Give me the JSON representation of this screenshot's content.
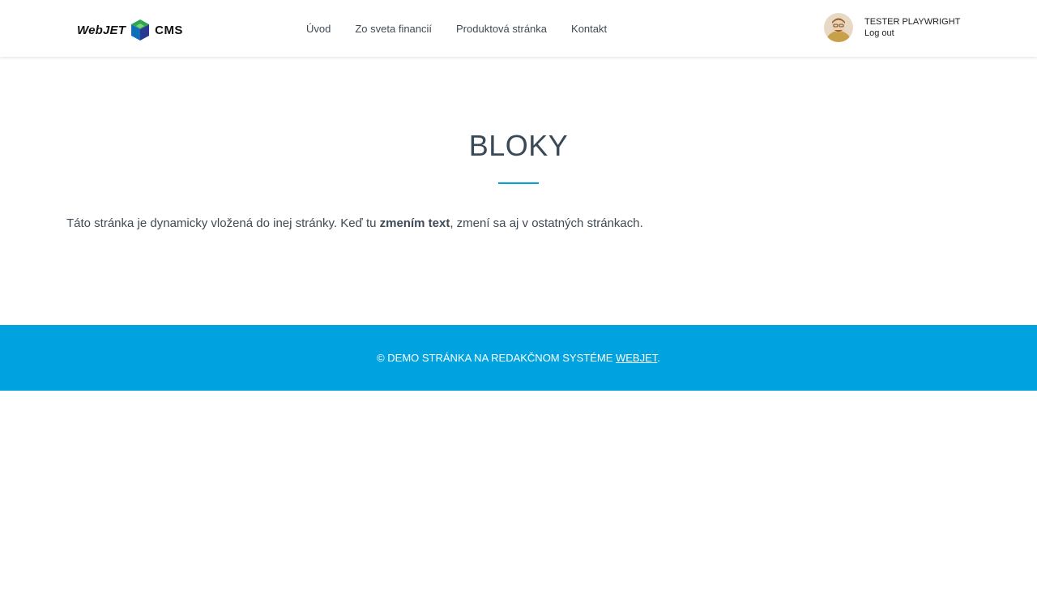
{
  "header": {
    "logo": {
      "text_left": "WebJET",
      "text_right": "CMS",
      "colors": [
        "#1fa84f",
        "#0f6fb8",
        "#2b3a8f"
      ]
    },
    "nav": [
      {
        "label": "Úvod"
      },
      {
        "label": "Zo sveta financií"
      },
      {
        "label": "Produktová stránka"
      },
      {
        "label": "Kontakt"
      }
    ],
    "user": {
      "name": "TESTER PLAYWRIGHT",
      "logout": "Log out"
    }
  },
  "main": {
    "title": "BLOKY",
    "text_before": "Táto stránka je dynamicky vložená do inej stránky. Keď tu ",
    "text_bold": "zmením text",
    "text_after": ", zmení sa aj v ostatných stránkach."
  },
  "footer": {
    "text_before": "© DEMO STRÁNKA NA REDAKČNOM SYSTÉME ",
    "link": "WEBJET",
    "text_after": "."
  },
  "colors": {
    "accent": "#00a3e0",
    "text": "#3f4a55"
  }
}
